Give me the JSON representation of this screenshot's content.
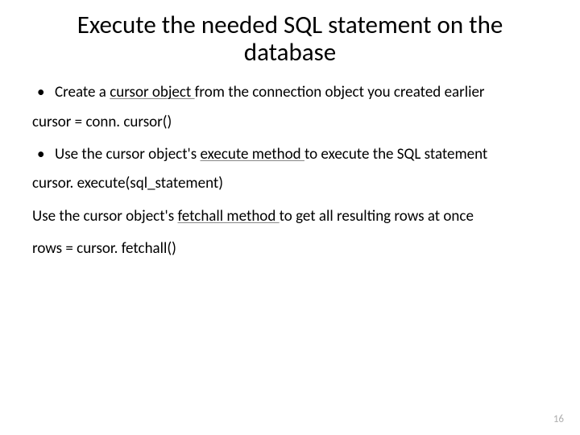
{
  "title": "Execute the needed SQL statement on the database",
  "bullet1_pre": "Create a ",
  "bullet1_u": "cursor object ",
  "bullet1_post": "from the connection object you created earlier",
  "code1": "cursor = conn. cursor()",
  "bullet2_pre": "Use the cursor object's ",
  "bullet2_u": "execute method ",
  "bullet2_post": "to execute the SQL statement",
  "code2": "cursor. execute(sql_statement)",
  "para3_pre": "Use the cursor object's ",
  "para3_u": "fetchall method ",
  "para3_post": "to get all resulting rows at once",
  "code3": "rows =  cursor. fetchall()",
  "pagenum": "16"
}
